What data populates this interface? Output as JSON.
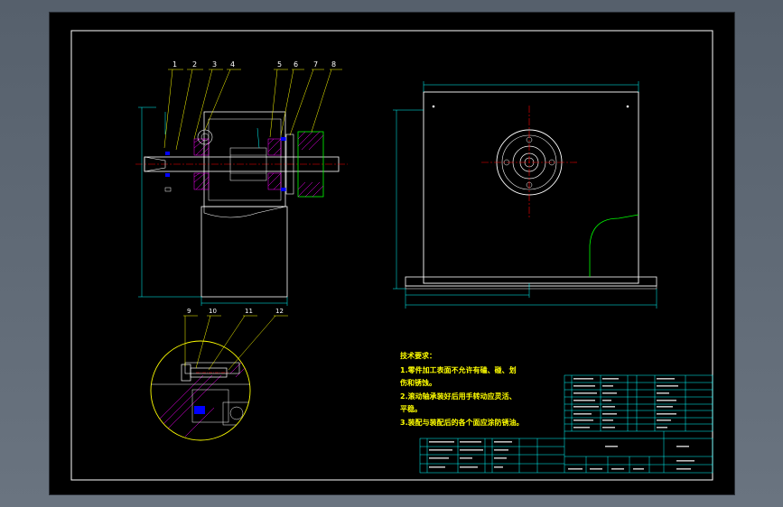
{
  "colors": {
    "viewport_bg": "#000000",
    "frame": "#ffffff",
    "dimension": "#00ffff",
    "leader_yellow": "#ffff00",
    "center_red": "#ff0000",
    "outline_green": "#00ff00",
    "hatch_magenta": "#ff00ff",
    "seal_blue": "#0000ff",
    "table_line": "#00ffff"
  },
  "part_labels": [
    "1",
    "2",
    "3",
    "4",
    "5",
    "6",
    "7",
    "8"
  ],
  "detail_labels": [
    "9",
    "10",
    "11",
    "12"
  ],
  "technical_notes": {
    "heading": "技术要求：",
    "lines": [
      "1.零件加工表面不允许有磕、碰、划",
      "伤和锈蚀。",
      "2.滚动轴承装好后用手转动应灵活、",
      "平稳。",
      "3.装配与装配后的各个面应涂防锈油。"
    ]
  },
  "icons": {
    "bolt": "hex-bolt-icon",
    "pulley": "pulley-icon",
    "bearing": "bearing-icon"
  }
}
